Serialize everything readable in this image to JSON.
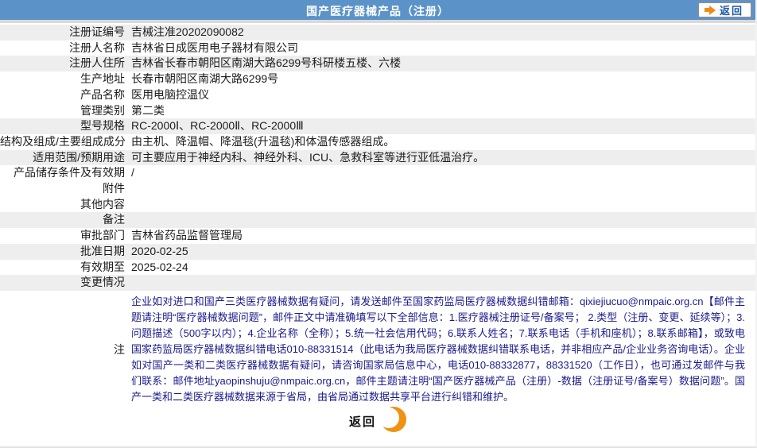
{
  "header": {
    "title": "国产医疗器械产品（注册）",
    "back_label": "返回"
  },
  "rows": [
    {
      "label": "注册证编号",
      "value": "吉械注准20202090082"
    },
    {
      "label": "注册人名称",
      "value": "吉林省日成医用电子器材有限公司"
    },
    {
      "label": "注册人住所",
      "value": "吉林省长春市朝阳区南湖大路6299号科研楼五楼、六楼"
    },
    {
      "label": "生产地址",
      "value": "长春市朝阳区南湖大路6299号"
    },
    {
      "label": "产品名称",
      "value": "医用电脑控温仪"
    },
    {
      "label": "管理类别",
      "value": "第二类"
    },
    {
      "label": "型号规格",
      "value": "RC-2000Ⅰ、RC-2000Ⅱ、RC-2000Ⅲ"
    },
    {
      "label": "结构及组成/主要组成成分",
      "value": "由主机、降温帽、降温毯(升温毯)和体温传感器组成。"
    },
    {
      "label": "适用范围/预期用途",
      "value": "可主要应用于神经内科、神经外科、ICU、急救科室等进行亚低温治疗。"
    },
    {
      "label": "产品储存条件及有效期",
      "value": "/"
    },
    {
      "label": "附件",
      "value": ""
    },
    {
      "label": "其他内容",
      "value": ""
    },
    {
      "label": "备注",
      "value": ""
    },
    {
      "label": "审批部门",
      "value": "吉林省药品监督管理局"
    },
    {
      "label": "批准日期",
      "value": "2020-02-25"
    },
    {
      "label": "有效期至",
      "value": "2025-02-24"
    },
    {
      "label": "变更情况",
      "value": ""
    }
  ],
  "note": {
    "label": "注",
    "text": "企业如对进口和国产三类医疗器械数据有疑问，请发送邮件至国家药监局医疗器械数据纠错邮箱：qixiejiucuo@nmpaic.org.cn【邮件主题请注明“医疗器械数据问题”，邮件正文中请准确填写以下全部信息：1.医疗器械注册证号/备案号； 2.类型（注册、变更、延续等）；3.问题描述（500字以内）；4.企业名称（全称）；5.统一社会信用代码；6.联系人姓名；7.联系电话（手机和座机）；8.联系邮箱】，或致电国家药监局医疗器械数据纠错电话010-88331514（此电话为我局医疗器械数据纠错联系电话，并非相应产品/企业业务咨询电话）。企业如对国产一类和二类医疗器械数据有疑问，请咨询国家局信息中心，电话010-88332877，88331520（工作日），也可通过发邮件与我们联系：邮件地址yaopinshuju@nmpaic.org.cn，邮件主题请注明“国产医疗器械产品（注册）-数据（注册证号/备案号）数据问题”。国产一类和二类医疗器械数据来源于省局，由省局通过数据共享平台进行纠错和维护。"
  },
  "footer": {
    "back_label": "返回"
  },
  "colors": {
    "header_blue": "#5b93c8",
    "row_shade_gray": "#eeeeee",
    "note_navy": "#1a1a8c",
    "accent_orange": "#f09111",
    "back_link_blue": "#1a57a8"
  }
}
